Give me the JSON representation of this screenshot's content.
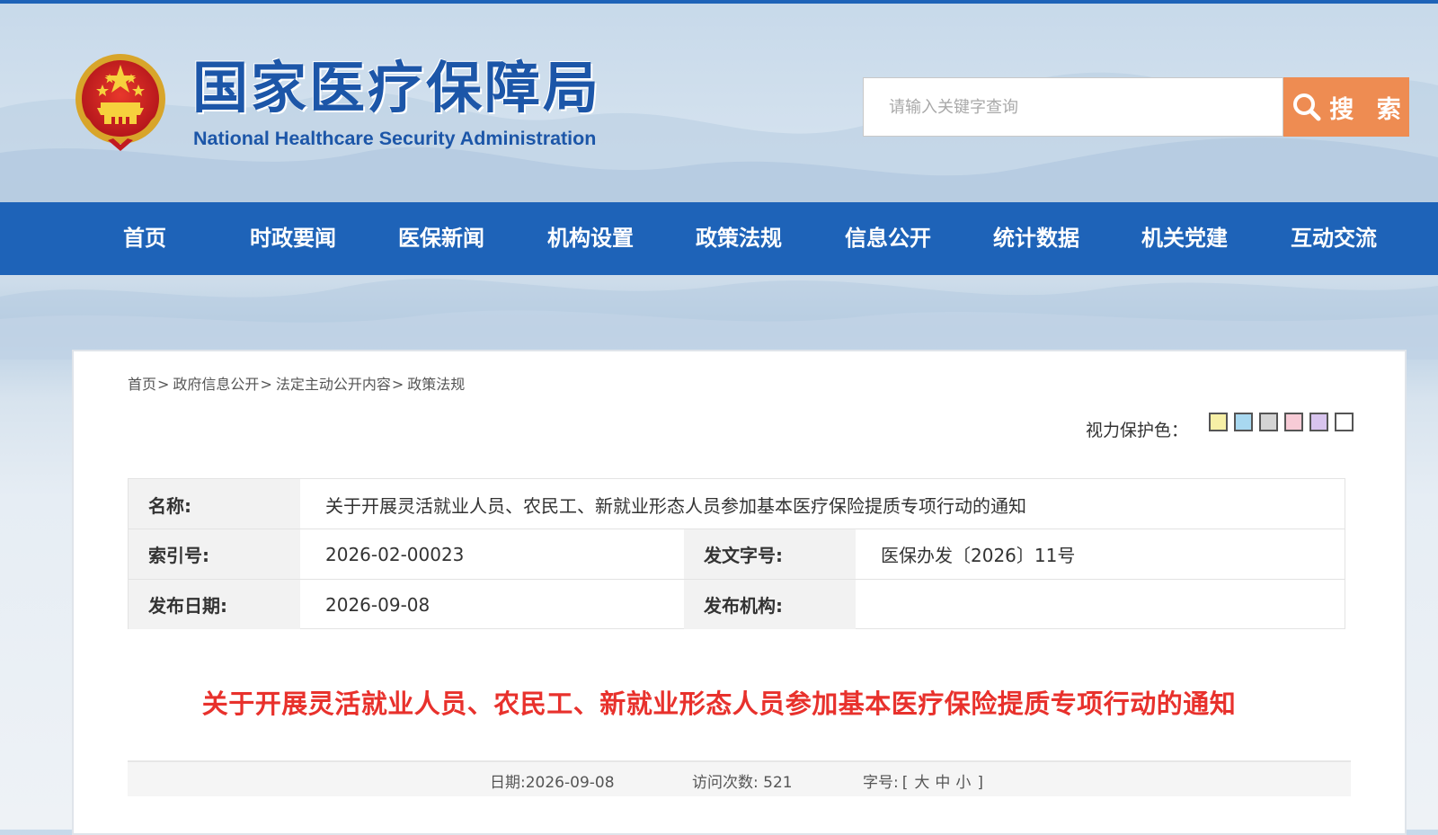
{
  "header": {
    "site_name_cn": "国家医疗保障局",
    "site_name_en": "National Healthcare Security Administration",
    "search": {
      "placeholder": "请输入关键字查询",
      "button_label": "搜 索"
    }
  },
  "nav": {
    "items": [
      "首页",
      "时政要闻",
      "医保新闻",
      "机构设置",
      "政策法规",
      "信息公开",
      "统计数据",
      "机关党建",
      "互动交流"
    ]
  },
  "breadcrumb": {
    "items": [
      "首页",
      "政府信息公开",
      "法定主动公开内容",
      "政策法规"
    ],
    "separator": ">"
  },
  "eye_protection": {
    "label": "视力保护色：",
    "colors": [
      "#f7f0a6",
      "#a8d8f0",
      "#d4d4d4",
      "#f7cbd6",
      "#d8c4ee",
      "#ffffff"
    ]
  },
  "meta": {
    "name_label": "名称:",
    "name_value": "关于开展灵活就业人员、农民工、新就业形态人员参加基本医疗保险提质专项行动的通知",
    "index_label": "索引号:",
    "index_value": "2026-02-00023",
    "docno_label": "发文字号:",
    "docno_value": "医保办发〔2026〕11号",
    "date_label": "发布日期:",
    "date_value": "2026-09-08",
    "org_label": "发布机构:",
    "org_value": ""
  },
  "article": {
    "title": "关于开展灵活就业人员、农民工、新就业形态人员参加基本医疗保险提质专项行动的通知",
    "date_label": "日期:",
    "date": "2026-09-08",
    "visits_label": "访问次数:",
    "visits": "521",
    "font_size_label": "字号:",
    "font_size_open": "[",
    "font_sizes": [
      "大",
      "中",
      "小"
    ],
    "font_size_close": "]"
  },
  "colors": {
    "primary_blue": "#1e63b8",
    "search_orange": "#ee8c52",
    "title_red": "#e8312c"
  }
}
